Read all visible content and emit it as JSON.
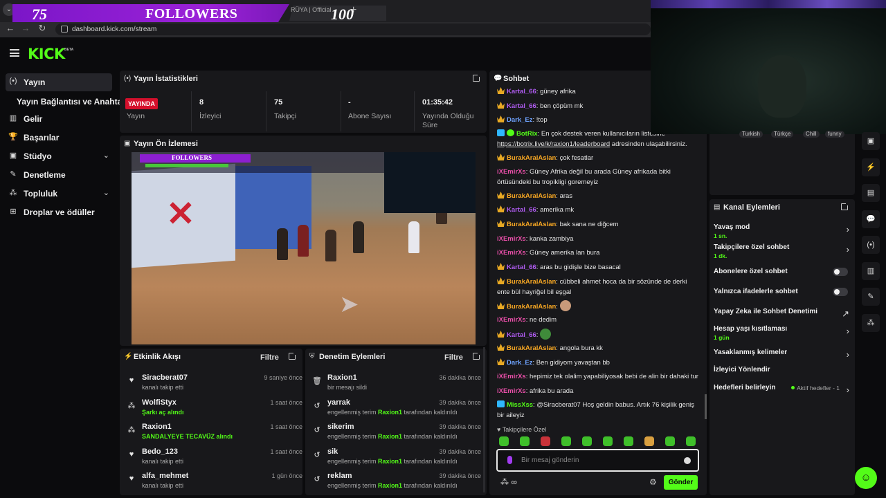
{
  "browser": {
    "tab_title": "RÜYA | Official",
    "url": "dashboard.kick.com/stream",
    "overlay": {
      "followers_count": "75",
      "followers_label": "FOLLOWERS",
      "followers_goal": "100"
    }
  },
  "brand": {
    "logo": "KICK",
    "beta": "BETA",
    "accent": "#53fc18"
  },
  "sidebar": {
    "items": [
      {
        "label": "Yayın",
        "icon": "broadcast-icon",
        "glyph": "(•)",
        "active": true
      },
      {
        "label": "Gelir",
        "icon": "chart-icon",
        "glyph": "▥"
      },
      {
        "label": "Başarılar",
        "icon": "trophy-icon",
        "glyph": "🏆"
      },
      {
        "label": "Stüdyo",
        "icon": "studio-icon",
        "glyph": "▣",
        "expandable": true
      },
      {
        "label": "Denetleme",
        "icon": "wrench-icon",
        "glyph": "✎"
      },
      {
        "label": "Topluluk",
        "icon": "community-icon",
        "glyph": "⁂",
        "expandable": true
      },
      {
        "label": "Droplar ve ödüller",
        "icon": "drops-icon",
        "glyph": "⊞"
      }
    ],
    "sub_item": "Yayın Bağlantısı ve Anahtarı"
  },
  "stats": {
    "title": "Yayın İstatistikleri",
    "live_badge": "YAYINDA",
    "cells": [
      {
        "label": "Yayın"
      },
      {
        "value": "8",
        "label": "İzleyici"
      },
      {
        "value": "75",
        "label": "Takipçi"
      },
      {
        "value": "-",
        "label": "Abone Sayısı"
      },
      {
        "value": "01:35:42",
        "label": "Yayında Olduğu Süre"
      }
    ]
  },
  "preview": {
    "title": "Yayın Ön İzlemesi",
    "hud_text": "FOLLOWERS"
  },
  "events": {
    "title": "Etkinlik Akışı",
    "filter": "Filtre",
    "items": [
      {
        "name": "Siracberat07",
        "sub": "kanalı takip etti",
        "time": "9 saniye önce",
        "icon": "heart-icon",
        "glyph": "♥"
      },
      {
        "name": "WolfiStyx",
        "sub": "Şarkı aç alındı",
        "time": "1 saat önce",
        "icon": "reward-icon",
        "glyph": "⁂",
        "highlight": true
      },
      {
        "name": "Raxion1",
        "sub": "SANDALYEYE TECAVÜZ alındı",
        "time": "1 saat önce",
        "icon": "reward-icon",
        "glyph": "⁂",
        "highlight": true
      },
      {
        "name": "Bedo_123",
        "sub": "kanalı takip etti",
        "time": "1 saat önce",
        "icon": "heart-icon",
        "glyph": "♥"
      },
      {
        "name": "alfa_mehmet",
        "sub": "kanalı takip etti",
        "time": "1 gün önce",
        "icon": "heart-icon",
        "glyph": "♥"
      }
    ]
  },
  "moderation": {
    "title": "Denetim Eylemleri",
    "filter": "Filtre",
    "items": [
      {
        "name": "Raxion1",
        "sub_pre": "bir mesajı sildi",
        "sub_mod": "",
        "sub_post": "",
        "time": "36 dakika önce",
        "icon": "trash-icon",
        "glyph": "🗑"
      },
      {
        "name": "yarrak",
        "sub_pre": "engellenmiş terim ",
        "sub_mod": "Raxion1",
        "sub_post": " tarafından kaldırıldı",
        "time": "39 dakika önce",
        "icon": "undo-icon",
        "glyph": "↺"
      },
      {
        "name": "sikerim",
        "sub_pre": "engellenmiş terim ",
        "sub_mod": "Raxion1",
        "sub_post": " tarafından kaldırıldı",
        "time": "39 dakika önce",
        "icon": "undo-icon",
        "glyph": "↺"
      },
      {
        "name": "sik",
        "sub_pre": "engellenmiş terim ",
        "sub_mod": "Raxion1",
        "sub_post": " tarafından kaldırıldı",
        "time": "39 dakika önce",
        "icon": "undo-icon",
        "glyph": "↺"
      },
      {
        "name": "reklam",
        "sub_pre": "engellenmiş terim ",
        "sub_mod": "Raxion1",
        "sub_post": " tarafından kaldırıldı",
        "time": "39 dakika önce",
        "icon": "undo-icon",
        "glyph": "↺"
      }
    ]
  },
  "chat": {
    "title": "Sohbet",
    "messages": [
      {
        "user": "Kartal_66",
        "color": "purple",
        "badge": "crown",
        "text": "güney afrika"
      },
      {
        "user": "Kartal_66",
        "color": "purple",
        "badge": "crown",
        "text": "ben çöpüm mk"
      },
      {
        "user": "Dark_Ez",
        "color": "blue",
        "badge": "crown",
        "text": "!top"
      },
      {
        "user": "BotRix",
        "color": "green",
        "badge": "bot",
        "text": "En çok destek veren kullanıcıların listesine",
        "link": "https://botrix.live/k/raxion1/leaderboard",
        "text2": " adresinden ulaşabilirsiniz."
      },
      {
        "user": "BurakAralAslan",
        "color": "orange",
        "badge": "crown",
        "text": "çok fesatlar"
      },
      {
        "user": "iXEmirXs",
        "color": "pink",
        "badge": "",
        "text": "Güney Afrika değil bu arada Güney afrikada bitki örtüsündeki bu tropikligi goremeyiz"
      },
      {
        "user": "BurakAralAslan",
        "color": "orange",
        "badge": "crown",
        "text": "aras"
      },
      {
        "user": "Kartal_66",
        "color": "purple",
        "badge": "crown",
        "text": "amerika mk"
      },
      {
        "user": "BurakAralAslan",
        "color": "orange",
        "badge": "crown",
        "text": "bak sana ne diğcem"
      },
      {
        "user": "iXEmirXs",
        "color": "pink",
        "badge": "",
        "text": "kanka zambiya"
      },
      {
        "user": "iXEmirXs",
        "color": "pink",
        "badge": "",
        "text": "Güney amerika lan bura"
      },
      {
        "user": "Kartal_66",
        "color": "purple",
        "badge": "crown",
        "text": "aras bu gidişle bize basacal"
      },
      {
        "user": "BurakAralAslan",
        "color": "orange",
        "badge": "crown",
        "text": "cübbeli ahmet hoca da bir sözünde de derki ente bül hayriğel bil eşgal"
      },
      {
        "user": "BurakAralAslan",
        "color": "orange",
        "badge": "crown",
        "text": "",
        "emote": "#c89a7a"
      },
      {
        "user": "iXEmirXs",
        "color": "pink",
        "badge": "",
        "text": "ne dedim"
      },
      {
        "user": "Kartal_66",
        "color": "purple",
        "badge": "crown",
        "text": "",
        "emote": "#3f8a3a"
      },
      {
        "user": "BurakAralAslan",
        "color": "orange",
        "badge": "crown",
        "text": "angola bura kk"
      },
      {
        "user": "Dark_Ez",
        "color": "blue",
        "badge": "crown",
        "text": "Ben gidiyom yavaştan bb"
      },
      {
        "user": "iXEmirXs",
        "color": "pink",
        "badge": "",
        "text": "hepimiz tek olalim yapabiliyosak bebi de alin bir dahaki tur"
      },
      {
        "user": "iXEmirXs",
        "color": "pink",
        "badge": "",
        "text": "afrika bu arada"
      },
      {
        "user": "MissXss",
        "color": "green",
        "badge": "bot",
        "text": "@Siracberat07 Hoş geldin babus. Artık 76 kişilik geniş bir aileyiz"
      }
    ],
    "emote_row_label": "Takipçilere Özel",
    "input_placeholder": "Bir mesaj gönderin",
    "send_label": "Gönder"
  },
  "tags": [
    "Turkish",
    "Türkçe",
    "Chill",
    "funny"
  ],
  "channel_actions": {
    "title": "Kanal Eylemleri",
    "items": [
      {
        "label": "Yavaş mod",
        "sub": "1 sn.",
        "control": "chevron"
      },
      {
        "label": "Takipçilere özel sohbet",
        "sub": "1 dk.",
        "control": "chevron"
      },
      {
        "label": "Abonelere özel sohbet",
        "sub": "",
        "control": "toggle",
        "enabled": false
      },
      {
        "label": "Yalnızca ifadelerle sohbet",
        "sub": "",
        "control": "toggle",
        "enabled": false
      },
      {
        "label": "Yapay Zeka ile Sohbet Denetimi",
        "sub": "",
        "control": "external"
      },
      {
        "label": "Hesap yaşı kısıtlaması",
        "sub": "1 gün",
        "control": "chevron"
      },
      {
        "label": "Yasaklanmış kelimeler",
        "sub": "",
        "control": "chevron"
      },
      {
        "label": "İzleyici Yönlendir",
        "sub": "",
        "control": "none"
      },
      {
        "label": "Hedefleri belirleyin",
        "sub": "",
        "control": "chevron",
        "hint": "Aktif hedefler - 1"
      }
    ]
  },
  "rail": [
    "clip-icon",
    "bolt-icon",
    "notes-icon",
    "chat-icon",
    "broadcast-icon",
    "layout-icon",
    "wrench-icon",
    "drops-icon"
  ]
}
